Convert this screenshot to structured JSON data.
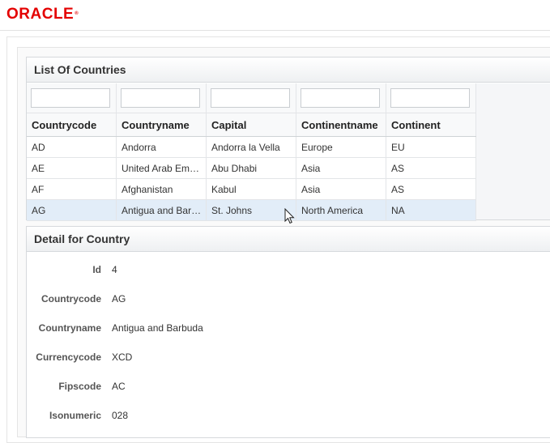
{
  "brand": {
    "logo_text": "ORACLE",
    "logo_mark": "®",
    "logo_color": "#e40000"
  },
  "list_panel": {
    "title": "List Of Countries",
    "columns": [
      "Countrycode",
      "Countryname",
      "Capital",
      "Continentname",
      "Continent"
    ],
    "rows": [
      [
        "AD",
        "Andorra",
        "Andorra la Vella",
        "Europe",
        "EU"
      ],
      [
        "AE",
        "United Arab Em…",
        "Abu Dhabi",
        "Asia",
        "AS"
      ],
      [
        "AF",
        "Afghanistan",
        "Kabul",
        "Asia",
        "AS"
      ],
      [
        "AG",
        "Antigua and Bar…",
        "St. Johns",
        "North America",
        "NA"
      ]
    ],
    "selected_row_index": 3
  },
  "detail_panel": {
    "title": "Detail for Country",
    "fields": [
      {
        "label": "Id",
        "value": "4"
      },
      {
        "label": "Countrycode",
        "value": "AG"
      },
      {
        "label": "Countryname",
        "value": "Antigua and Barbuda"
      },
      {
        "label": "Currencycode",
        "value": "XCD"
      },
      {
        "label": "Fipscode",
        "value": "AC"
      },
      {
        "label": "Isonumeric",
        "value": "028"
      }
    ]
  },
  "colors": {
    "selected_row": "#e2edf8",
    "panel_border": "#d6d9dc"
  }
}
